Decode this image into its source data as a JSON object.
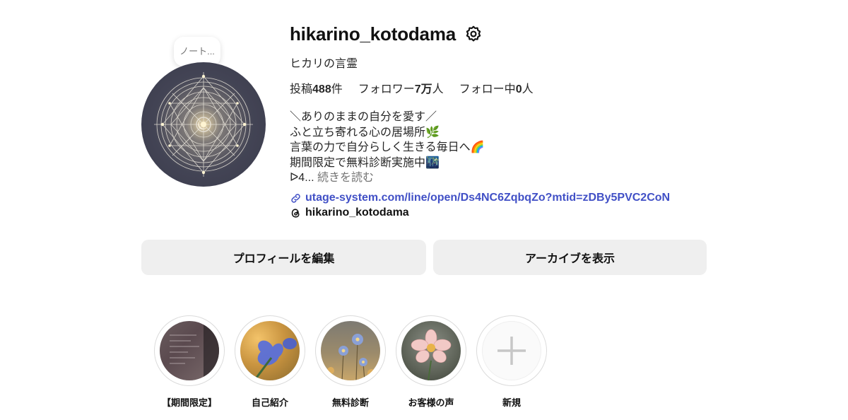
{
  "profile": {
    "username": "hikarino_kotodama",
    "full_name": "ヒカリの言霊",
    "note": "ノート...",
    "stats": {
      "posts_label": "投稿",
      "posts_count": "488",
      "posts_unit": "件",
      "followers_label": "フォロワー",
      "followers_count": "7万",
      "followers_unit": "人",
      "following_label": "フォロー中",
      "following_count": "0",
      "following_unit": "人"
    },
    "bio": {
      "line1": "＼ありのままの自分を愛す／",
      "line2": "ふと立ち寄れる心の居場所🌿",
      "line3": "言葉の力で自分らしく生きる毎日へ🌈",
      "line4": "期間限定で無料診断実施中🌃",
      "line5_prefix": "ᐅ4...",
      "more": "続きを読む"
    },
    "link": "utage-system.com/line/open/Ds4NC6ZqbqZo?mtid=zDBy5PVC2CoN",
    "threads_handle": "hikarino_kotodama"
  },
  "buttons": {
    "edit_profile": "プロフィールを編集",
    "view_archive": "アーカイブを表示"
  },
  "highlights": [
    {
      "label": "【期間限定】"
    },
    {
      "label": "自己紹介"
    },
    {
      "label": "無料診断"
    },
    {
      "label": "お客様の声"
    },
    {
      "label": "新規"
    }
  ],
  "colors": {
    "link": "#4150c6",
    "button_bg": "#efefef"
  }
}
